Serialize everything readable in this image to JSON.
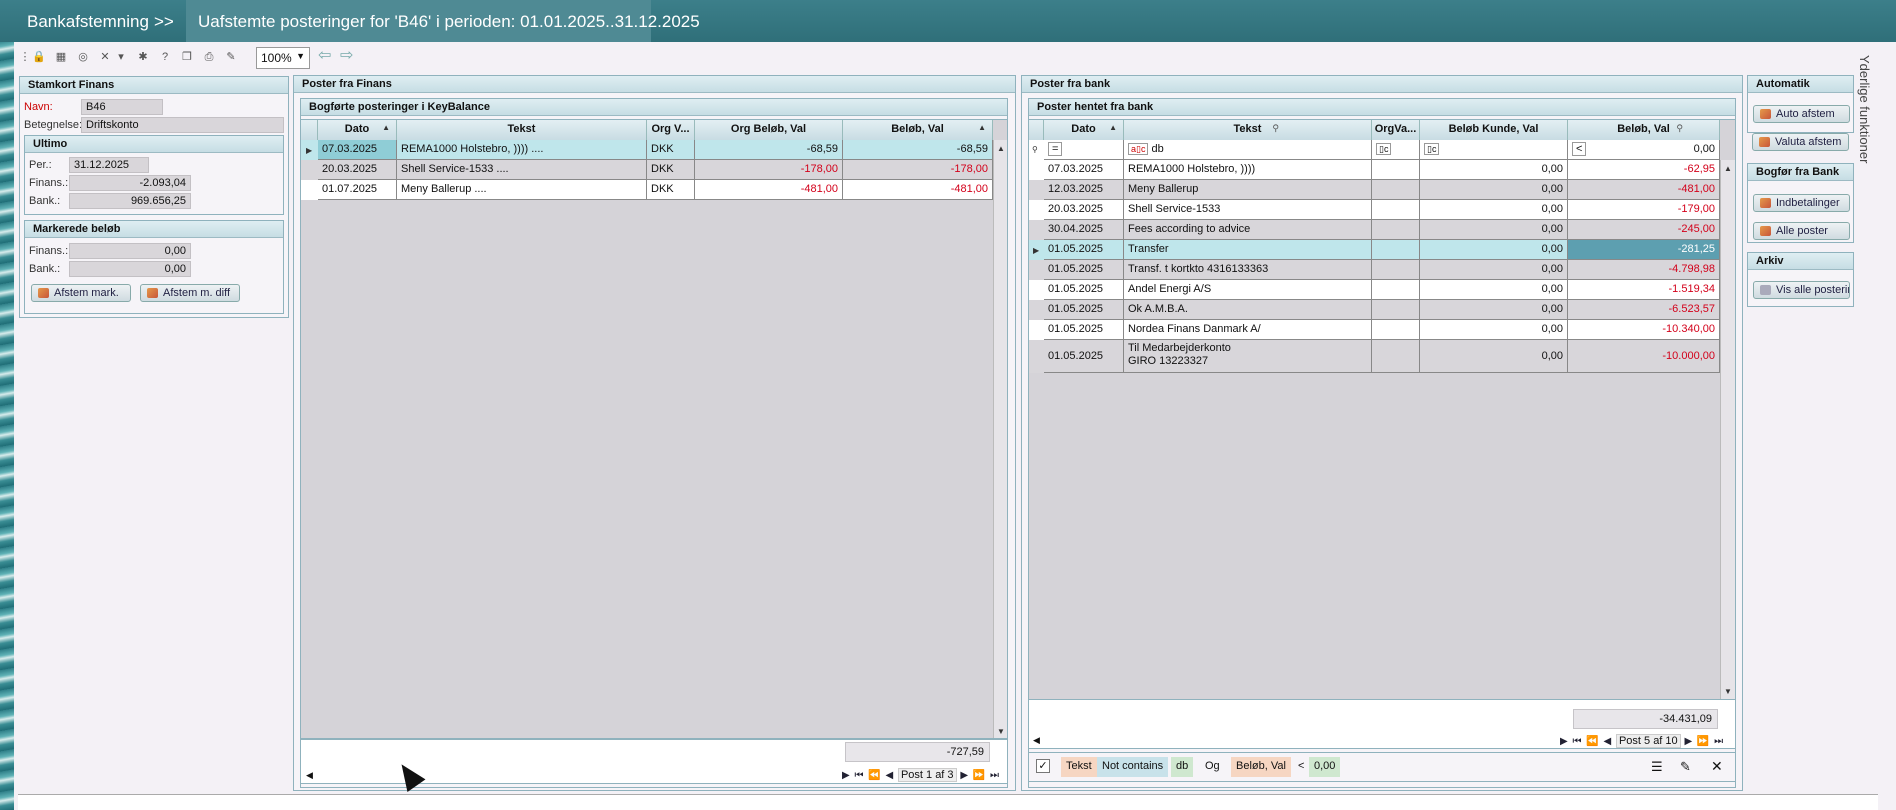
{
  "titlebar": {
    "crumb": "Bankafstemning",
    "separator": ">>",
    "active_tab": "Uafstemte posteringer for 'B46' i perioden: 01.01.2025..31.12.2025"
  },
  "toolbar": {
    "zoom": "100%",
    "icons": [
      "lock-icon",
      "calculator-icon",
      "refresh-icon",
      "tools-icon",
      "dropdown-icon",
      "bug-icon",
      "help-icon",
      "copy-icon",
      "export-icon",
      "edit-icon"
    ]
  },
  "stamkort": {
    "title": "Stamkort Finans",
    "navn_label": "Navn:",
    "navn_value": "B46",
    "betegnelse_label": "Betegnelse:",
    "betegnelse_value": "Driftskonto",
    "ultimo_title": "Ultimo",
    "per_label": "Per.:",
    "per_value": "31.12.2025",
    "finans_label": "Finans.:",
    "finans_value": "-2.093,04",
    "bank_label": "Bank.:",
    "bank_value": "969.656,25",
    "markerede_title": "Markerede beløb",
    "m_finans_label": "Finans.:",
    "m_finans_value": "0,00",
    "m_bank_label": "Bank.:",
    "m_bank_value": "0,00",
    "btn_afstem_mark": "Afstem mark.",
    "btn_afstem_diff": "Afstem m. diff"
  },
  "finans": {
    "title": "Poster fra Finans",
    "subtitle": "Bogførte posteringer i KeyBalance",
    "columns": [
      "Dato",
      "Tekst",
      "Org V...",
      "Org Beløb, Val",
      "Beløb, Val"
    ],
    "rows": [
      {
        "dato": "07.03.2025",
        "tekst": "REMA1000 Holstebro,  )))) ....",
        "org_v": "DKK",
        "org_belob": "-68,59",
        "belob": "-68,59"
      },
      {
        "dato": "20.03.2025",
        "tekst": "Shell Service-1533 ....",
        "org_v": "DKK",
        "org_belob": "-178,00",
        "belob": "-178,00"
      },
      {
        "dato": "01.07.2025",
        "tekst": "Meny Ballerup ....",
        "org_v": "DKK",
        "org_belob": "-481,00",
        "belob": "-481,00"
      }
    ],
    "total": "-727,59",
    "pager": "Post 1 af 3"
  },
  "bank": {
    "title": "Poster fra bank",
    "subtitle": "Poster hentet fra bank",
    "columns": [
      "Dato",
      "Tekst",
      "OrgVa...",
      "Beløb Kunde, Val",
      "Beløb, Val"
    ],
    "filter": {
      "dato_op": "=",
      "tekst_value": "db",
      "belob_op": "<",
      "belob_value": "0,00"
    },
    "rows": [
      {
        "dato": "07.03.2025",
        "tekst": "REMA1000 Holstebro,  ))))",
        "kunde": "0,00",
        "belob": "-62,95"
      },
      {
        "dato": "12.03.2025",
        "tekst": "Meny Ballerup",
        "kunde": "0,00",
        "belob": "-481,00"
      },
      {
        "dato": "20.03.2025",
        "tekst": "Shell Service-1533",
        "kunde": "0,00",
        "belob": "-179,00"
      },
      {
        "dato": "30.04.2025",
        "tekst": "Fees according to advice",
        "kunde": "0,00",
        "belob": "-245,00"
      },
      {
        "dato": "01.05.2025",
        "tekst": "Transfer",
        "kunde": "0,00",
        "belob": "-281,25"
      },
      {
        "dato": "01.05.2025",
        "tekst": "Transf. t kortkto 4316133363",
        "kunde": "0,00",
        "belob": "-4.798,98"
      },
      {
        "dato": "01.05.2025",
        "tekst": "Andel Energi A/S",
        "kunde": "0,00",
        "belob": "-1.519,34"
      },
      {
        "dato": "01.05.2025",
        "tekst": "Ok A.M.B.A.",
        "kunde": "0,00",
        "belob": "-6.523,57"
      },
      {
        "dato": "01.05.2025",
        "tekst": "Nordea Finans Danmark A/",
        "kunde": "0,00",
        "belob": "-10.340,00"
      },
      {
        "dato": "01.05.2025",
        "tekst": "Til Medarbejderkonto",
        "tekst2": "GIRO 13223327",
        "kunde": "0,00",
        "belob": "-10.000,00"
      }
    ],
    "total": "-34.431,09",
    "pager": "Post 5 af 10",
    "filter_chips": {
      "field1": "Tekst",
      "op1": "Not contains",
      "val1": "db",
      "join": "Og",
      "field2": "Beløb, Val",
      "op2": "<",
      "val2": "0,00"
    }
  },
  "automatik": {
    "title": "Automatik",
    "auto_afstem": "Auto afstem",
    "valuta_afstem": "Valuta afstem",
    "bogfor_title": "Bogfør fra Bank",
    "indbetalinger": "Indbetalinger",
    "alle_poster": "Alle poster",
    "arkiv_title": "Arkiv",
    "vis_alle": "Vis alle posteringer"
  },
  "side_label": "Yderlige funktioner"
}
